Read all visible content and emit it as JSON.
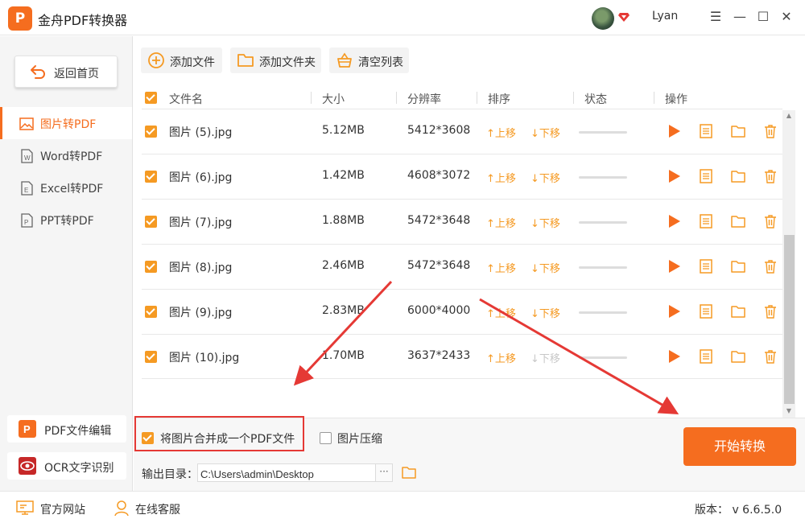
{
  "app": {
    "logo_char": "P",
    "title": "金舟PDF转换器",
    "user": "Lyan",
    "window_controls": [
      "☰",
      "—",
      "☐",
      "✕"
    ]
  },
  "sidebar": {
    "back_label": "返回首页",
    "items": [
      {
        "label": "图片转PDF",
        "icon": "image-icon",
        "active": true
      },
      {
        "label": "Word转PDF",
        "icon": "word-doc-icon",
        "active": false
      },
      {
        "label": "Excel转PDF",
        "icon": "excel-doc-icon",
        "active": false
      },
      {
        "label": "PPT转PDF",
        "icon": "ppt-doc-icon",
        "active": false
      }
    ],
    "tools": [
      {
        "label": "PDF文件编辑",
        "icon": "pdf-edit-icon"
      },
      {
        "label": "OCR文字识别",
        "icon": "ocr-eye-icon"
      }
    ]
  },
  "toolbar": {
    "add_file": "添加文件",
    "add_folder": "添加文件夹",
    "clear_list": "清空列表"
  },
  "table": {
    "headers": {
      "name": "文件名",
      "size": "大小",
      "resolution": "分辨率",
      "order": "排序",
      "status": "状态",
      "actions": "操作"
    },
    "move_up": "↑上移",
    "move_down": "↓下移",
    "rows": [
      {
        "name": "图片 (5).jpg",
        "size": "5.12MB",
        "resolution": "5412*3608"
      },
      {
        "name": "图片 (6).jpg",
        "size": "1.42MB",
        "resolution": "4608*3072"
      },
      {
        "name": "图片 (7).jpg",
        "size": "1.88MB",
        "resolution": "5472*3648"
      },
      {
        "name": "图片 (8).jpg",
        "size": "2.46MB",
        "resolution": "5472*3648"
      },
      {
        "name": "图片 (9).jpg",
        "size": "2.83MB",
        "resolution": "6000*4000"
      },
      {
        "name": "图片 (10).jpg",
        "size": "1.70MB",
        "resolution": "3637*2433"
      }
    ]
  },
  "options": {
    "merge_label": "将图片合并成一个PDF文件",
    "merge_checked": true,
    "compress_label": "图片压缩",
    "compress_checked": false
  },
  "output": {
    "label": "输出目录：",
    "path": "C:\\Users\\admin\\Desktop",
    "browse": "···"
  },
  "start_button": "开始转换",
  "footer": {
    "website": "官方网站",
    "support": "在线客服",
    "version": "版本： v 6.6.5.0"
  },
  "colors": {
    "accent": "#f56d1f",
    "checkbox": "#f59a23",
    "annotation": "#e53935"
  }
}
